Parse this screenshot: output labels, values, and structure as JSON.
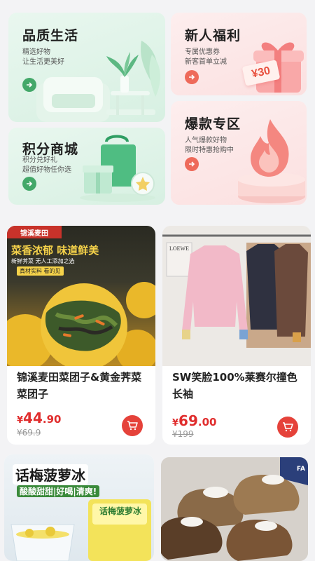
{
  "banners": [
    {
      "title": "品质生活",
      "sub1": "精选好物",
      "sub2": "让生活更美好"
    },
    {
      "title": "新人福利",
      "sub1": "专属优惠券",
      "sub2": "新客首单立减",
      "coupon": "¥30"
    },
    {
      "title": "积分商城",
      "sub1": "积分兑好礼",
      "sub2": "超值好物任你选"
    },
    {
      "title": "爆款专区",
      "sub1": "人气爆款好物",
      "sub2": "限时特惠抢购中"
    }
  ],
  "products": [
    {
      "name": "锦溪麦田菜团子&黄金荠菜菜团子",
      "price_symbol": "¥",
      "price_int": "44",
      "price_dec": ".90",
      "orig_price": "¥69.9",
      "img_brand": "锦溪麦田",
      "img_headline": "菜香浓郁 味道鲜美",
      "img_tagline": "新鲜荠菜  无人工添加之选",
      "img_note": "真材实料 看的见"
    },
    {
      "name": "SW笑脸100%莱赛尔撞色长袖",
      "price_symbol": "¥",
      "price_int": "69",
      "price_dec": ".00",
      "orig_price": "¥199",
      "img_sign": "LOEWE"
    },
    {
      "img_headline": "话梅菠萝冰",
      "img_tagline": "酸酸甜甜|好喝|清爽!",
      "img_pack": "话梅菠萝冰"
    },
    {
      "img_tag": "FA"
    }
  ],
  "colors": {
    "accent_red": "#e5423a",
    "price_red": "#e02d2d",
    "green": "#43a869",
    "coral": "#ee6a5a"
  }
}
